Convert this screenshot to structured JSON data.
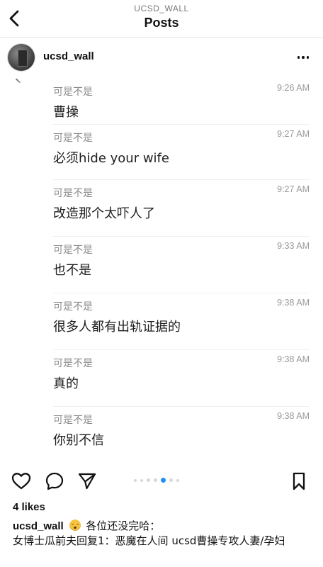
{
  "header": {
    "account": "UCSD_WALL",
    "title": "Posts"
  },
  "post": {
    "author": "ucsd_wall",
    "likes": "4 likes",
    "caption": {
      "user": "ucsd_wall",
      "emoji": "tired-face-emoji",
      "line1": "各位还没完哈：",
      "line2": "女博士瓜前夫回复1：恶魔在人间 ucsd曹操专攻人妻/孕妇"
    }
  },
  "messages": [
    {
      "sender": "可是不是",
      "time": "9:26 AM",
      "text": "曹操"
    },
    {
      "sender": "可是不是",
      "time": "9:27 AM",
      "text": "必须hide your wife"
    },
    {
      "sender": "可是不是",
      "time": "9:27 AM",
      "text": "改造那个太吓人了"
    },
    {
      "sender": "可是不是",
      "time": "9:33 AM",
      "text": "也不是"
    },
    {
      "sender": "可是不是",
      "time": "9:38 AM",
      "text": "很多人都有出轨证据的"
    },
    {
      "sender": "可是不是",
      "time": "9:38 AM",
      "text": "真的"
    },
    {
      "sender": "可是不是",
      "time": "9:38 AM",
      "text": "你别不信"
    }
  ],
  "carousel": {
    "current_index": 4,
    "visible_indicators": 7
  },
  "icons": {
    "back": "chevron-left-icon",
    "more": "more-horizontal-icon",
    "like": "heart-icon",
    "comment": "comment-icon",
    "share": "send-icon",
    "save": "bookmark-icon"
  },
  "colors": {
    "accent": "#1f8ef1",
    "text": "#111111",
    "muted": "#8a8a8a",
    "divider": "#efefef"
  }
}
